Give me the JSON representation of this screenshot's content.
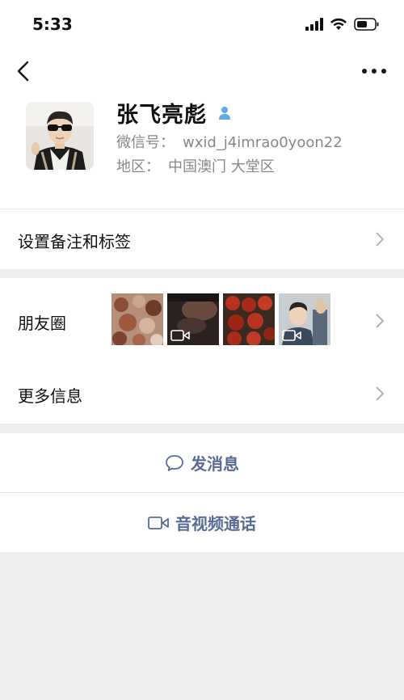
{
  "status_bar": {
    "time": "5:33"
  },
  "profile": {
    "name": "张飞亮彪",
    "wechat_id_label": "微信号：",
    "wechat_id": "wxid_j4imrao0yoon22",
    "region_label": "地区：",
    "region": "中国澳门 大堂区"
  },
  "rows": {
    "tags_label": "设置备注和标签",
    "moments_label": "朋友圈",
    "more_info_label": "更多信息"
  },
  "moments_thumbs": [
    {
      "kind": "image",
      "icon": "food-photo"
    },
    {
      "kind": "video",
      "icon": "video-icon"
    },
    {
      "kind": "image",
      "icon": "food-photo"
    },
    {
      "kind": "video",
      "icon": "video-icon"
    }
  ],
  "actions": {
    "message_label": "发消息",
    "call_label": "音视频通话"
  },
  "colors": {
    "link_blue": "#576b95",
    "gender_blue": "#62a9e8",
    "bg_gray": "#ededed"
  }
}
